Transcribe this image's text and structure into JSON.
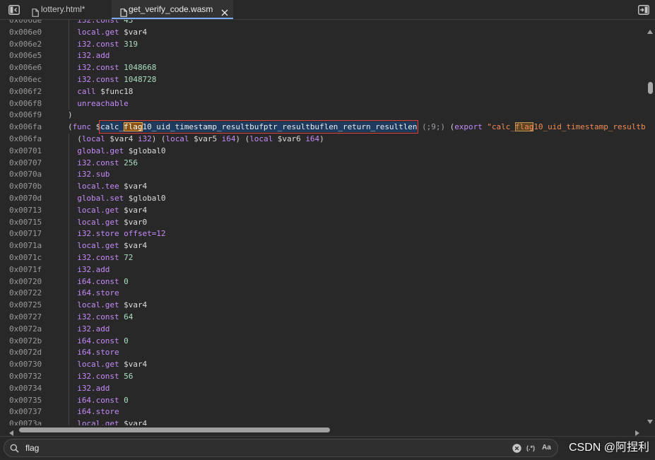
{
  "tab_bar": {
    "left_icon": "toggle-navigator-icon",
    "right_icon": "toggle-debugger-icon",
    "tabs": [
      {
        "label": "lottery.html*",
        "icon": "file-icon",
        "active": false
      },
      {
        "label": "get_verify_code.wasm",
        "icon": "file-icon",
        "close_icon": "close-icon",
        "active": true
      }
    ]
  },
  "editor": {
    "lines": [
      {
        "addr": "0x006de",
        "indent": 1,
        "tokens": [
          {
            "t": "i32.const ",
            "c": "kw"
          },
          {
            "t": "43",
            "c": "num"
          }
        ]
      },
      {
        "addr": "0x006e0",
        "indent": 1,
        "tokens": [
          {
            "t": "local.get ",
            "c": "kw"
          },
          {
            "t": "$var4",
            "c": "var"
          }
        ]
      },
      {
        "addr": "0x006e2",
        "indent": 1,
        "tokens": [
          {
            "t": "i32.const ",
            "c": "kw"
          },
          {
            "t": "319",
            "c": "num"
          }
        ]
      },
      {
        "addr": "0x006e5",
        "indent": 1,
        "tokens": [
          {
            "t": "i32.add",
            "c": "kw"
          }
        ]
      },
      {
        "addr": "0x006e6",
        "indent": 1,
        "tokens": [
          {
            "t": "i32.const ",
            "c": "kw"
          },
          {
            "t": "1048668",
            "c": "num"
          }
        ]
      },
      {
        "addr": "0x006ec",
        "indent": 1,
        "tokens": [
          {
            "t": "i32.const ",
            "c": "kw"
          },
          {
            "t": "1048728",
            "c": "num"
          }
        ]
      },
      {
        "addr": "0x006f2",
        "indent": 1,
        "tokens": [
          {
            "t": "call ",
            "c": "kw"
          },
          {
            "t": "$func18",
            "c": "var"
          }
        ]
      },
      {
        "addr": "0x006f8",
        "indent": 1,
        "tokens": [
          {
            "t": "unreachable",
            "c": "kw"
          }
        ]
      },
      {
        "addr": "0x006f9",
        "indent": 0,
        "tokens": [
          {
            "t": ")",
            "c": "punc"
          }
        ]
      },
      {
        "addr": "0x006fa",
        "indent": 0,
        "tokens": [
          {
            "t": "(",
            "c": "punc"
          },
          {
            "t": "func ",
            "c": "kw"
          },
          {
            "t": "$",
            "c": "var"
          },
          {
            "c": "name-box",
            "parts": [
              {
                "t": "calc_",
                "c": "fn"
              },
              {
                "t": "flag",
                "c": "fn match-current"
              },
              {
                "t": "10_uid_timestamp_resultbufptr_resultbuflen_return_resultlen",
                "c": "fn"
              }
            ]
          },
          {
            "t": " ",
            "c": "punc"
          },
          {
            "t": "(;9;)",
            "c": "cmt"
          },
          {
            "t": " (",
            "c": "punc"
          },
          {
            "t": "export ",
            "c": "kw"
          },
          {
            "t": "\"calc_",
            "c": "str"
          },
          {
            "t": "flag",
            "c": "str match"
          },
          {
            "t": "10_uid_timestamp_resultb",
            "c": "str"
          }
        ]
      },
      {
        "addr": "0x006fa",
        "indent": 1,
        "tokens": [
          {
            "t": "(",
            "c": "punc"
          },
          {
            "t": "local ",
            "c": "kw"
          },
          {
            "t": "$var4 ",
            "c": "var"
          },
          {
            "t": "i32",
            "c": "kw"
          },
          {
            "t": ") (",
            "c": "punc"
          },
          {
            "t": "local ",
            "c": "kw"
          },
          {
            "t": "$var5 ",
            "c": "var"
          },
          {
            "t": "i64",
            "c": "kw"
          },
          {
            "t": ") (",
            "c": "punc"
          },
          {
            "t": "local ",
            "c": "kw"
          },
          {
            "t": "$var6 ",
            "c": "var"
          },
          {
            "t": "i64",
            "c": "kw"
          },
          {
            "t": ")",
            "c": "punc"
          }
        ]
      },
      {
        "addr": "0x00701",
        "indent": 1,
        "tokens": [
          {
            "t": "global.get ",
            "c": "kw"
          },
          {
            "t": "$global0",
            "c": "var"
          }
        ]
      },
      {
        "addr": "0x00707",
        "indent": 1,
        "tokens": [
          {
            "t": "i32.const ",
            "c": "kw"
          },
          {
            "t": "256",
            "c": "num"
          }
        ]
      },
      {
        "addr": "0x0070a",
        "indent": 1,
        "tokens": [
          {
            "t": "i32.sub",
            "c": "kw"
          }
        ]
      },
      {
        "addr": "0x0070b",
        "indent": 1,
        "tokens": [
          {
            "t": "local.tee ",
            "c": "kw"
          },
          {
            "t": "$var4",
            "c": "var"
          }
        ]
      },
      {
        "addr": "0x0070d",
        "indent": 1,
        "tokens": [
          {
            "t": "global.set ",
            "c": "kw"
          },
          {
            "t": "$global0",
            "c": "var"
          }
        ]
      },
      {
        "addr": "0x00713",
        "indent": 1,
        "tokens": [
          {
            "t": "local.get ",
            "c": "kw"
          },
          {
            "t": "$var4",
            "c": "var"
          }
        ]
      },
      {
        "addr": "0x00715",
        "indent": 1,
        "tokens": [
          {
            "t": "local.get ",
            "c": "kw"
          },
          {
            "t": "$var0",
            "c": "var"
          }
        ]
      },
      {
        "addr": "0x00717",
        "indent": 1,
        "tokens": [
          {
            "t": "i32.store offset=12",
            "c": "kw"
          }
        ]
      },
      {
        "addr": "0x0071a",
        "indent": 1,
        "tokens": [
          {
            "t": "local.get ",
            "c": "kw"
          },
          {
            "t": "$var4",
            "c": "var"
          }
        ]
      },
      {
        "addr": "0x0071c",
        "indent": 1,
        "tokens": [
          {
            "t": "i32.const ",
            "c": "kw"
          },
          {
            "t": "72",
            "c": "num"
          }
        ]
      },
      {
        "addr": "0x0071f",
        "indent": 1,
        "tokens": [
          {
            "t": "i32.add",
            "c": "kw"
          }
        ]
      },
      {
        "addr": "0x00720",
        "indent": 1,
        "tokens": [
          {
            "t": "i64.const ",
            "c": "kw"
          },
          {
            "t": "0",
            "c": "num"
          }
        ]
      },
      {
        "addr": "0x00722",
        "indent": 1,
        "tokens": [
          {
            "t": "i64.store",
            "c": "kw"
          }
        ]
      },
      {
        "addr": "0x00725",
        "indent": 1,
        "tokens": [
          {
            "t": "local.get ",
            "c": "kw"
          },
          {
            "t": "$var4",
            "c": "var"
          }
        ]
      },
      {
        "addr": "0x00727",
        "indent": 1,
        "tokens": [
          {
            "t": "i32.const ",
            "c": "kw"
          },
          {
            "t": "64",
            "c": "num"
          }
        ]
      },
      {
        "addr": "0x0072a",
        "indent": 1,
        "tokens": [
          {
            "t": "i32.add",
            "c": "kw"
          }
        ]
      },
      {
        "addr": "0x0072b",
        "indent": 1,
        "tokens": [
          {
            "t": "i64.const ",
            "c": "kw"
          },
          {
            "t": "0",
            "c": "num"
          }
        ]
      },
      {
        "addr": "0x0072d",
        "indent": 1,
        "tokens": [
          {
            "t": "i64.store",
            "c": "kw"
          }
        ]
      },
      {
        "addr": "0x00730",
        "indent": 1,
        "tokens": [
          {
            "t": "local.get ",
            "c": "kw"
          },
          {
            "t": "$var4",
            "c": "var"
          }
        ]
      },
      {
        "addr": "0x00732",
        "indent": 1,
        "tokens": [
          {
            "t": "i32.const ",
            "c": "kw"
          },
          {
            "t": "56",
            "c": "num"
          }
        ]
      },
      {
        "addr": "0x00734",
        "indent": 1,
        "tokens": [
          {
            "t": "i32.add",
            "c": "kw"
          }
        ]
      },
      {
        "addr": "0x00735",
        "indent": 1,
        "tokens": [
          {
            "t": "i64.const ",
            "c": "kw"
          },
          {
            "t": "0",
            "c": "num"
          }
        ]
      },
      {
        "addr": "0x00737",
        "indent": 1,
        "tokens": [
          {
            "t": "i64.store",
            "c": "kw"
          }
        ]
      },
      {
        "addr": "0x0073a",
        "indent": 1,
        "tokens": [
          {
            "t": "local.get ",
            "c": "kw"
          },
          {
            "t": "$var4",
            "c": "var"
          }
        ]
      }
    ]
  },
  "search": {
    "search_icon": "search-icon",
    "query": "flag",
    "clear_icon": "clear-search-icon",
    "regex_label": "(.*)",
    "case_label": "Aa"
  },
  "watermark": "CSDN @阿捏利",
  "colors": {
    "background": "#282828",
    "gutter": "#9a9a9a",
    "keyword": "#c58af9",
    "identifier": "#dcdcdc",
    "number": "#aadfc0",
    "punctuation": "#d4d4d4",
    "comment": "#9aa0a6",
    "string": "#f28b54",
    "function-name": "#e8eaed",
    "accent": "#7cacf8",
    "match-current": "#8a5211",
    "match": "#5c4523",
    "name-box-outline": "#e0443e",
    "name-box-fill": "#1e3b5e"
  }
}
